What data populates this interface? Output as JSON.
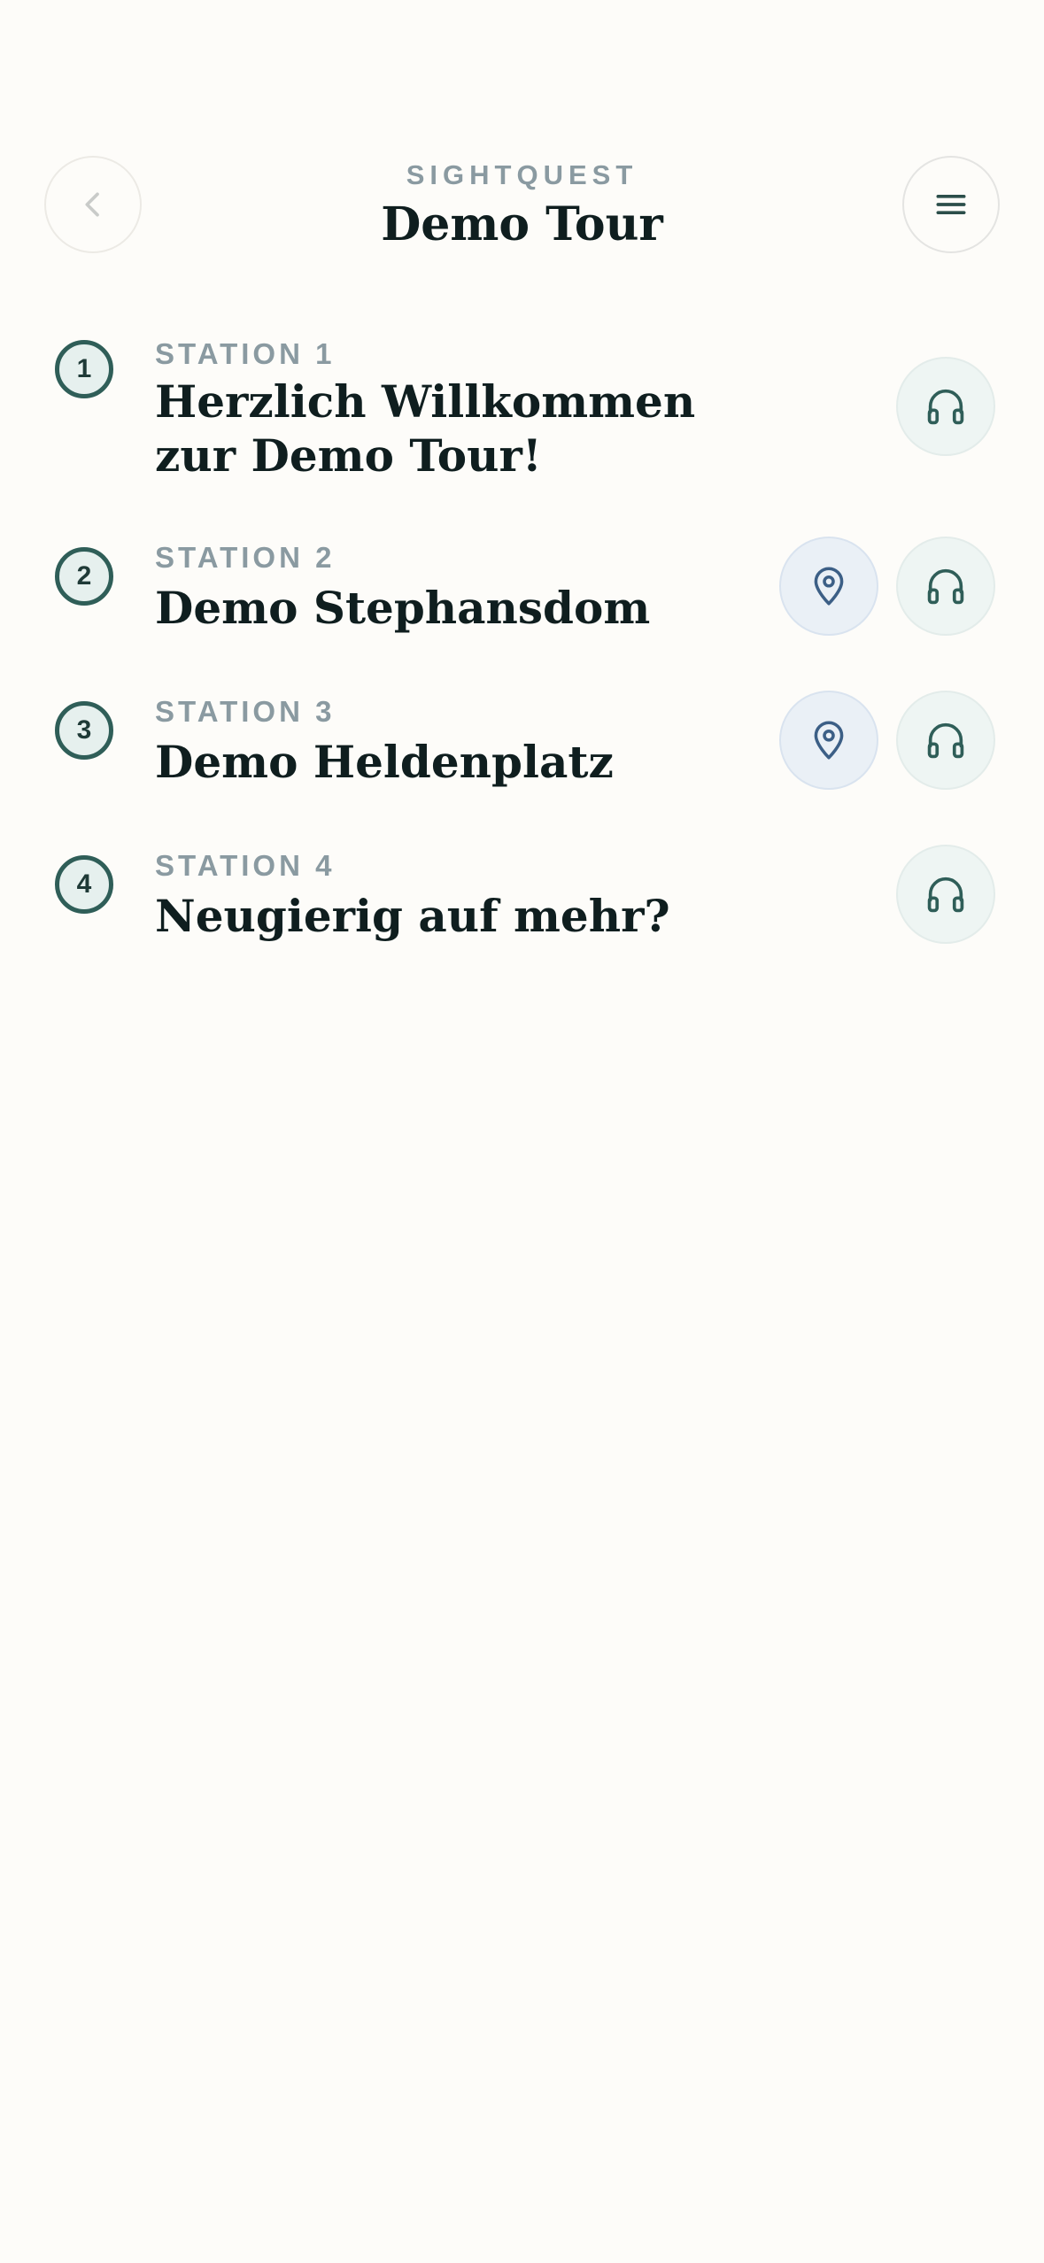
{
  "header": {
    "brand": "SIGHTQUEST",
    "title": "Demo Tour",
    "back_icon": "chevron-left-icon",
    "menu_icon": "hamburger-menu-icon"
  },
  "stations": [
    {
      "number": "1",
      "label": "STATION 1",
      "name": "Herzlich Willkommen zur Demo Tour!",
      "has_map": false,
      "has_audio": true
    },
    {
      "number": "2",
      "label": "STATION 2",
      "name": "Demo Stephansdom",
      "has_map": true,
      "has_audio": true
    },
    {
      "number": "3",
      "label": "STATION 3",
      "name": "Demo Heldenplatz",
      "has_map": true,
      "has_audio": true
    },
    {
      "number": "4",
      "label": "STATION 4",
      "name": "Neugierig auf mehr?",
      "has_map": false,
      "has_audio": true
    }
  ],
  "icons": {
    "map": "map-pin-icon",
    "audio": "headphones-icon"
  },
  "colors": {
    "background": "#fdfcf9",
    "accent_green": "#2f5e58",
    "accent_blue": "#3c5f86",
    "muted_text": "#8a9aa1",
    "heading_text": "#0f1e1f"
  }
}
